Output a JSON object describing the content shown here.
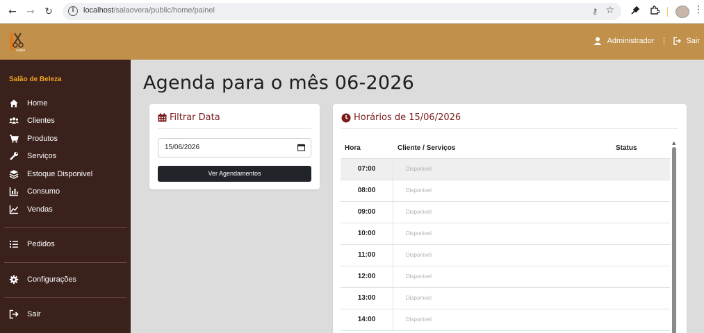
{
  "browser": {
    "url_host": "localhost",
    "url_path": "/salaovera/public/home/painel"
  },
  "topbar": {
    "user_label": "Administrador",
    "logout_label": "Sair"
  },
  "sidebar": {
    "brand": "Salão de Beleza",
    "items": [
      {
        "label": "Home",
        "icon": "home-icon"
      },
      {
        "label": "Clientes",
        "icon": "users-icon"
      },
      {
        "label": "Produtos",
        "icon": "cart-icon"
      },
      {
        "label": "Serviços",
        "icon": "wrench-icon"
      },
      {
        "label": "Estoque Disponivel",
        "icon": "layers-icon"
      },
      {
        "label": "Consumo",
        "icon": "bar-chart-icon"
      },
      {
        "label": "Vendas",
        "icon": "line-chart-icon"
      },
      {
        "label": "Pedidos",
        "icon": "list-icon"
      },
      {
        "label": "Configurações",
        "icon": "gear-icon"
      },
      {
        "label": "Sair",
        "icon": "logout-icon"
      }
    ]
  },
  "main": {
    "title": "Agenda para o mês 06-2026"
  },
  "filter": {
    "title": "Filtrar Data",
    "date_value": "15/06/2026",
    "button_label": "Ver Agendamentos"
  },
  "hours": {
    "title": "Horários de 15/06/2026",
    "columns": [
      "Hora",
      "Cliente / Serviços",
      "Status"
    ],
    "rows": [
      {
        "hora": "07:00",
        "cliente": "Disponivel"
      },
      {
        "hora": "08:00",
        "cliente": "Disponivel"
      },
      {
        "hora": "09:00",
        "cliente": "Disponivel"
      },
      {
        "hora": "10:00",
        "cliente": "Disponivel"
      },
      {
        "hora": "11:00",
        "cliente": "Disponivel"
      },
      {
        "hora": "12:00",
        "cliente": "Disponivel"
      },
      {
        "hora": "13:00",
        "cliente": "Disponivel"
      },
      {
        "hora": "14:00",
        "cliente": "Disponivel"
      }
    ]
  },
  "colors": {
    "topbar": "#c1904b",
    "sidebar": "#3a211c",
    "brand": "#f3a51f",
    "card_title": "#7a1c1c",
    "button": "#212529"
  }
}
